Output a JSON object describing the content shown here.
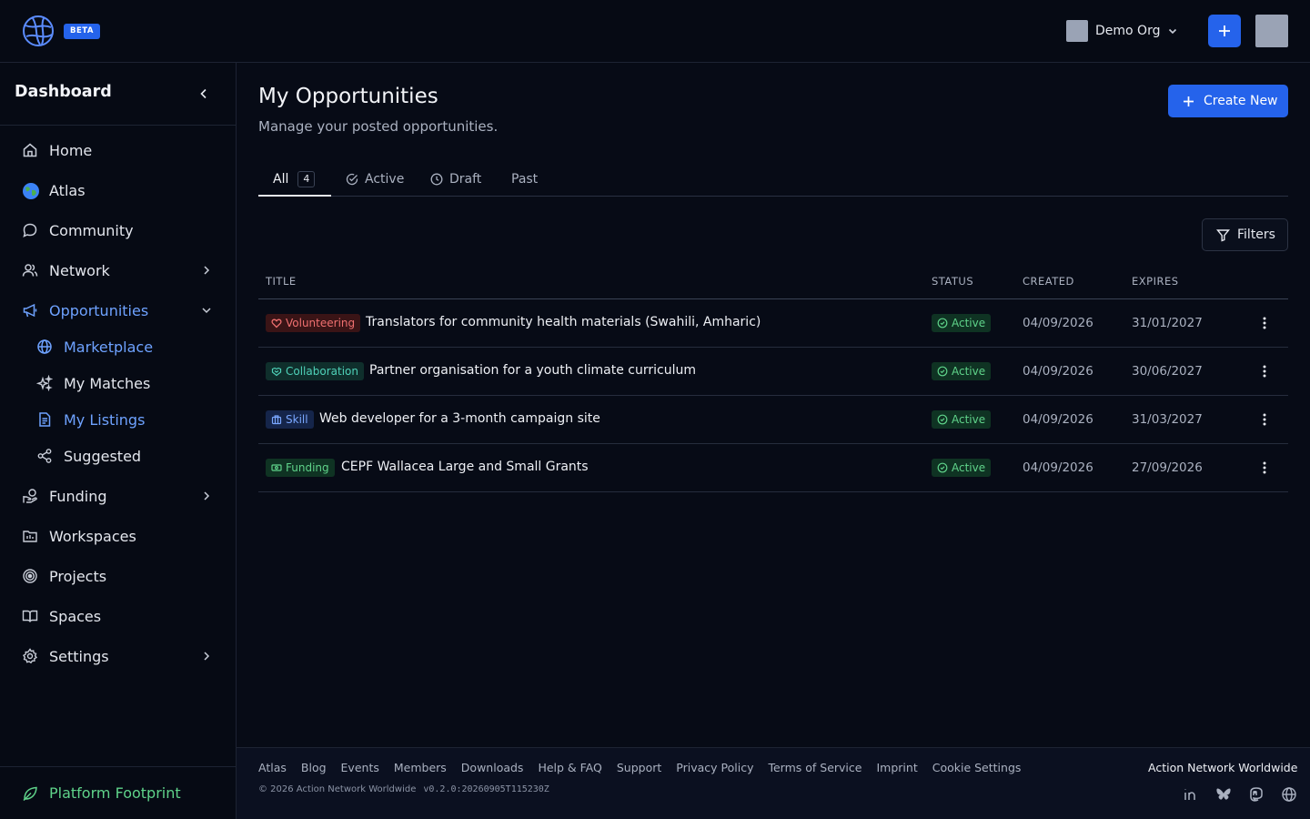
{
  "header": {
    "badge": "BETA",
    "org_name": "Demo Org"
  },
  "sidebar": {
    "title": "Dashboard",
    "items": [
      {
        "label": "Home",
        "icon": "home-icon"
      },
      {
        "label": "Atlas",
        "icon": "globe-emoji-icon"
      },
      {
        "label": "Community",
        "icon": "chat-bubble-icon"
      },
      {
        "label": "Network",
        "icon": "users-icon"
      },
      {
        "label": "Opportunities",
        "icon": "megaphone-icon"
      },
      {
        "label": "Marketplace",
        "icon": "globe-icon"
      },
      {
        "label": "My Matches",
        "icon": "sparkles-icon"
      },
      {
        "label": "My Listings",
        "icon": "document-icon"
      },
      {
        "label": "Suggested",
        "icon": "share-icon"
      },
      {
        "label": "Funding",
        "icon": "hand-coins-icon"
      },
      {
        "label": "Workspaces",
        "icon": "folder-icon"
      },
      {
        "label": "Projects",
        "icon": "target-icon"
      },
      {
        "label": "Spaces",
        "icon": "book-open-icon"
      },
      {
        "label": "Settings",
        "icon": "gear-icon"
      }
    ],
    "footer_label": "Platform Footprint"
  },
  "main": {
    "title": "My Opportunities",
    "subtitle": "Manage your posted opportunities.",
    "create_label": "Create New",
    "tabs": [
      {
        "label": "All",
        "count": "4"
      },
      {
        "label": "Active"
      },
      {
        "label": "Draft"
      },
      {
        "label": "Past"
      }
    ],
    "filters_label": "Filters",
    "columns": [
      "TITLE",
      "STATUS",
      "CREATED",
      "EXPIRES"
    ],
    "rows": [
      {
        "category": "Volunteering",
        "title": "Translators for community health materials (Swahili, Amharic)",
        "status": "Active",
        "created": "04/09/2026",
        "expires": "31/01/2027"
      },
      {
        "category": "Collaboration",
        "title": "Partner organisation for a youth climate curriculum",
        "status": "Active",
        "created": "04/09/2026",
        "expires": "30/06/2027"
      },
      {
        "category": "Skill",
        "title": "Web developer for a 3-month campaign site",
        "status": "Active",
        "created": "04/09/2026",
        "expires": "31/03/2027"
      },
      {
        "category": "Funding",
        "title": "CEPF Wallacea Large and Small Grants",
        "status": "Active",
        "created": "04/09/2026",
        "expires": "27/09/2026"
      }
    ]
  },
  "footer": {
    "links": [
      "Atlas",
      "Blog",
      "Events",
      "Members",
      "Downloads",
      "Help & FAQ",
      "Support",
      "Privacy Policy",
      "Terms of Service",
      "Imprint",
      "Cookie Settings"
    ],
    "copyright": "© 2026 Action Network Worldwide",
    "version": "v0.2.0:20260905T115230Z",
    "brand": "Action Network Worldwide",
    "socials": [
      "linkedin-icon",
      "bluesky-icon",
      "mastodon-icon",
      "website-icon"
    ]
  },
  "colors": {
    "accent": "#2563eb",
    "active_nav": "#6ea2ff",
    "success": "#5fd38a",
    "volunteering": "#f07070",
    "collaboration": "#4fd1b8",
    "skill": "#7aa7ff",
    "funding": "#5fd38a"
  }
}
